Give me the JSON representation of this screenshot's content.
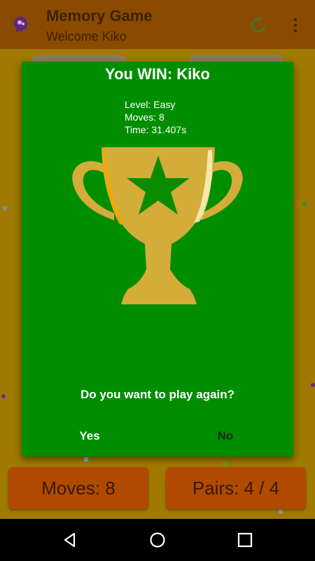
{
  "appbar": {
    "title": "Memory Game",
    "subtitle": "Welcome Kiko",
    "logo_icon": "brain-head-icon",
    "refresh_icon": "refresh-icon",
    "menu_icon": "more-vert-icon"
  },
  "stats_bar": {
    "moves": "Moves: 8",
    "pairs": "Pairs: 4 / 4"
  },
  "dialog": {
    "title": "You WIN: Kiko",
    "level": "Level: Easy",
    "moves": "Moves: 8",
    "time": "Time: 31.407s",
    "trophy_icon": "trophy-star-icon",
    "question": "Do you want to play again?",
    "yes_label": "Yes",
    "no_label": "No"
  },
  "navbar": {
    "back_icon": "back-triangle-icon",
    "home_icon": "home-circle-icon",
    "recent_icon": "recent-apps-square-icon"
  },
  "colors": {
    "app_background": "#a07a00",
    "appbar": "#8a4a00",
    "dialog": "#008e00",
    "trophy": "#d4ac3a",
    "stat_box": "#b04a00"
  }
}
